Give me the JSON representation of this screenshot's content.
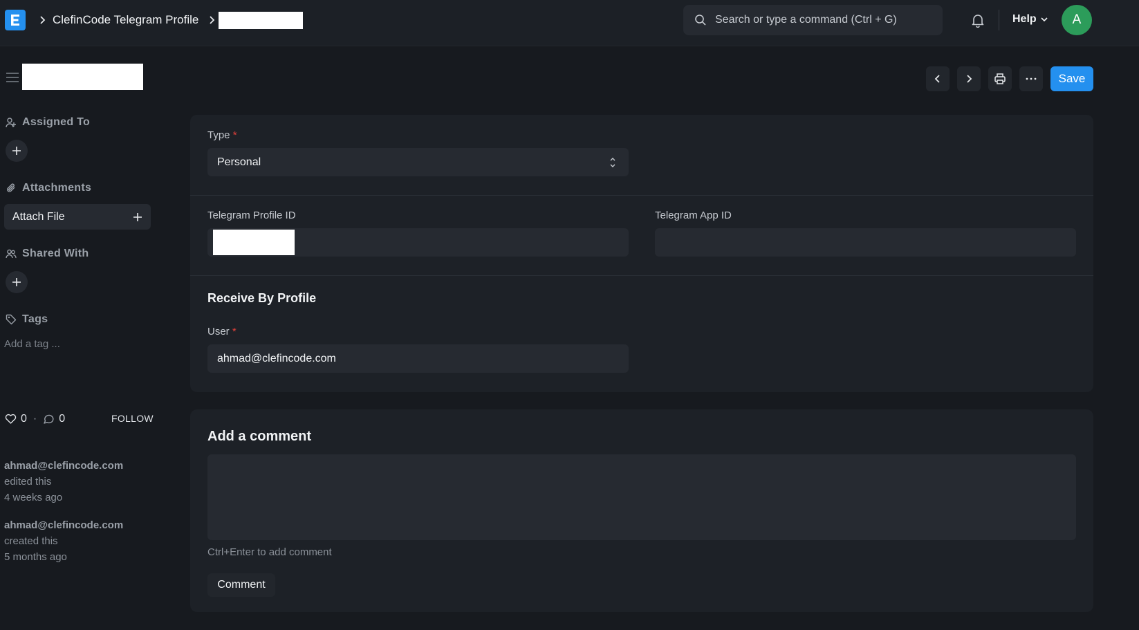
{
  "navbar": {
    "breadcrumb_doctype": "ClefinCode Telegram Profile",
    "search_placeholder": "Search or type a command (Ctrl + G)",
    "help_label": "Help",
    "avatar_initial": "A"
  },
  "toolbar": {
    "save_label": "Save"
  },
  "sidebar": {
    "assigned_to_label": "Assigned To",
    "attachments_label": "Attachments",
    "attach_file_label": "Attach File",
    "shared_with_label": "Shared With",
    "tags_label": "Tags",
    "add_tag_placeholder": "Add a tag ...",
    "likes_count": "0",
    "separator": "·",
    "comments_count": "0",
    "follow_label": "FOLLOW",
    "activity": [
      {
        "user": "ahmad@clefincode.com",
        "action": "edited this",
        "time": "4 weeks ago"
      },
      {
        "user": "ahmad@clefincode.com",
        "action": "created this",
        "time": "5 months ago"
      }
    ]
  },
  "form": {
    "type_label": "Type",
    "type_value": "Personal",
    "telegram_profile_id_label": "Telegram Profile ID",
    "telegram_app_id_label": "Telegram App ID",
    "telegram_app_id_value": "",
    "section_receive_by_profile": "Receive By Profile",
    "user_label": "User",
    "user_value": "ahmad@clefincode.com",
    "required_mark": "*"
  },
  "comments": {
    "title": "Add a comment",
    "hint": "Ctrl+Enter to add comment",
    "button_label": "Comment"
  },
  "colors": {
    "accent": "#2490ef",
    "avatar_bg": "#2c9c5a",
    "required": "#e0403a"
  }
}
